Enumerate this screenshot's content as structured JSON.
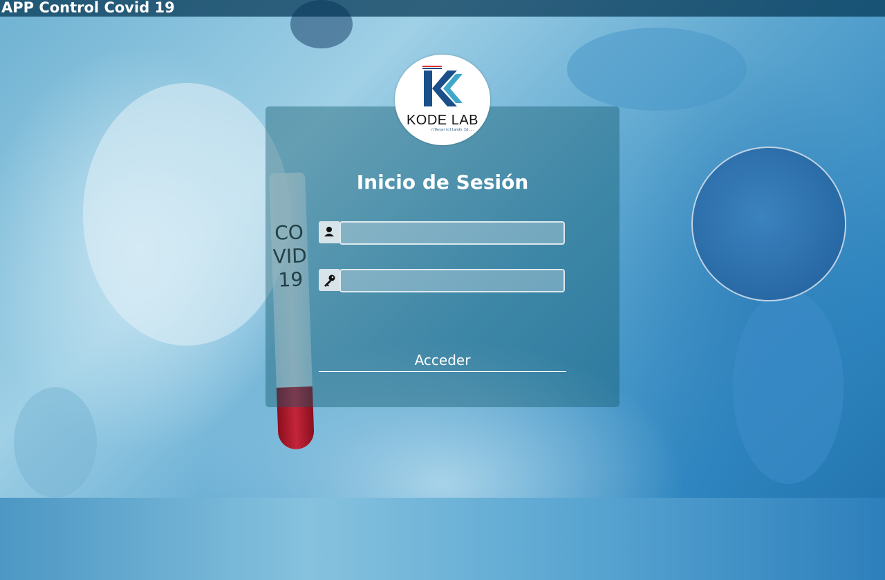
{
  "app": {
    "title": "APP Control Covid 19"
  },
  "logo": {
    "text": "KODE LAB",
    "tagline": "//Desarrollando Id..."
  },
  "background": {
    "tube_label": "COVID19"
  },
  "login": {
    "title": "Inicio de Sesión",
    "username": {
      "icon": "user-icon",
      "value": "",
      "placeholder": ""
    },
    "password": {
      "icon": "key-icon",
      "value": "",
      "placeholder": ""
    },
    "submit_label": "Acceder"
  },
  "colors": {
    "card_overlay": "#145a6e",
    "topbar": "#003250",
    "text": "#ffffff",
    "logo_blue": "#1a4f8a",
    "logo_teal": "#3fa7c9"
  }
}
